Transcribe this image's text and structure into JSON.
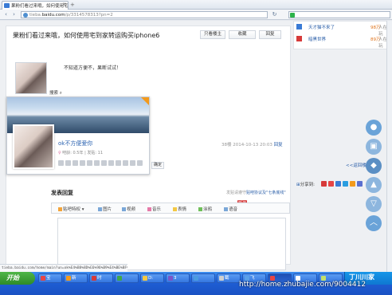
{
  "browser": {
    "tab_title": "果粉们看过来哦，如何使用宅",
    "address_prefix": "tieba.",
    "address_domain": "baidu.com",
    "address_path": "/p/3314578313?pn=2"
  },
  "thread": {
    "title": "果粉们看过来哦，如何使用宅到家转运购买iphone6",
    "btn_louzhu": "只看楼主",
    "btn_collect": "收藏",
    "btn_reply": "回复"
  },
  "right_panel": {
    "items": [
      {
        "name": "天才猫不来了",
        "count": "98万",
        "suffix": "人在玩"
      },
      {
        "name": "暗黑世界",
        "count": "89万",
        "suffix": "人在玩"
      }
    ]
  },
  "post": {
    "text": "不知道方便不，果断试试！",
    "search_label": "搜索"
  },
  "user_card": {
    "name": "ok不方便爱你",
    "tieba_age": "吧龄: 0.5年",
    "posts": "发贴: 11"
  },
  "floor_meta": {
    "floor": "38楼",
    "time": "2014-10-13 20:03",
    "reply_link": "回复"
  },
  "actions": {
    "confirm": "确定",
    "back_top": "<<返回楼",
    "share": "分享到:"
  },
  "reply": {
    "heading": "发表回复",
    "note_prefix": "发贴请遵守",
    "note_link": "贴吧协议及\"七条底线\"",
    "new_badge": "NEW",
    "tools": [
      {
        "label": "贴吧特权",
        "icon": "privilege-icon"
      },
      {
        "label": "图片",
        "icon": "image-icon"
      },
      {
        "label": "视频",
        "icon": "video-icon"
      },
      {
        "label": "音乐",
        "icon": "music-icon"
      },
      {
        "label": "表情",
        "icon": "emoji-icon"
      },
      {
        "label": "涂鸦",
        "icon": "doodle-icon"
      },
      {
        "label": "语音",
        "icon": "voice-icon"
      }
    ]
  },
  "status_bar": "tieba.baidu.com/home/main?un=ok%E4%B8%8D%E6%96%B9%E4%BE%BF%E7%88%B1%E4%BD%A0&fr=",
  "taskbar": {
    "start": "开始",
    "items": [
      {
        "label": "宝",
        "color": "#e64545"
      },
      {
        "label": "新",
        "color": "#f39a1c"
      },
      {
        "label": "时",
        "color": "#d63a3a"
      },
      {
        "label": "",
        "color": "#3ea64a"
      },
      {
        "label": "D:",
        "color": "#f3c844"
      },
      {
        "label": "3",
        "color": "#7a55c8"
      },
      {
        "label": "",
        "color": "#4a9be0"
      },
      {
        "label": "截",
        "color": "#cfcfcf"
      },
      {
        "label": "飞",
        "color": "#5aa0e8"
      },
      {
        "label": "",
        "color": "#e64545"
      },
      {
        "label": "",
        "color": "#ffffff"
      },
      {
        "label": "",
        "color": "#c3e06a"
      }
    ]
  },
  "watermark": "http://home.zhubajie.com/9004412",
  "clock": "丁川川家"
}
